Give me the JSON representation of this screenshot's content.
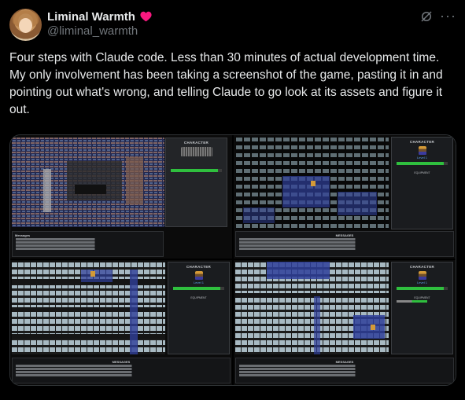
{
  "author": {
    "name": "Liminal Warmth",
    "handle": "@liminal_warmth",
    "avatar_icon": "avatar-image",
    "badge_icon": "heart-icon"
  },
  "tweet": {
    "text": "Four steps with Claude code. Less than 30 minutes of actual development time. My only involvement has been taking a screenshot of the game, pasting it in and pointing out what's wrong, and telling Claude to go look at its assets and figure it out."
  },
  "media": {
    "screenshots": [
      {
        "id": "step-1",
        "panel_title": "CHARACTER",
        "messages_title": "Messages"
      },
      {
        "id": "step-2",
        "panel_title": "CHARACTER",
        "level": "Level 1",
        "equipment_title": "EQUIPMENT",
        "messages_title": "MESSAGES"
      },
      {
        "id": "step-3",
        "panel_title": "CHARACTER",
        "level": "Level 1",
        "equipment_title": "EQUIPMENT",
        "messages_title": "MESSAGES"
      },
      {
        "id": "step-4",
        "panel_title": "CHARACTER",
        "level": "Level 1",
        "equipment_title": "EQUIPMENT",
        "messages_title": "MESSAGES"
      }
    ]
  },
  "colors": {
    "background": "#000000",
    "text": "#e7e9ea",
    "secondary_text": "#71767b",
    "heart": "#f91880",
    "hp_bar": "#2fbf3e",
    "dungeon_wall": "#9fb7c4",
    "dungeon_water": "#3a4fa8"
  },
  "header_icons": {
    "grok": "grok-icon",
    "more": "more-options-icon"
  }
}
